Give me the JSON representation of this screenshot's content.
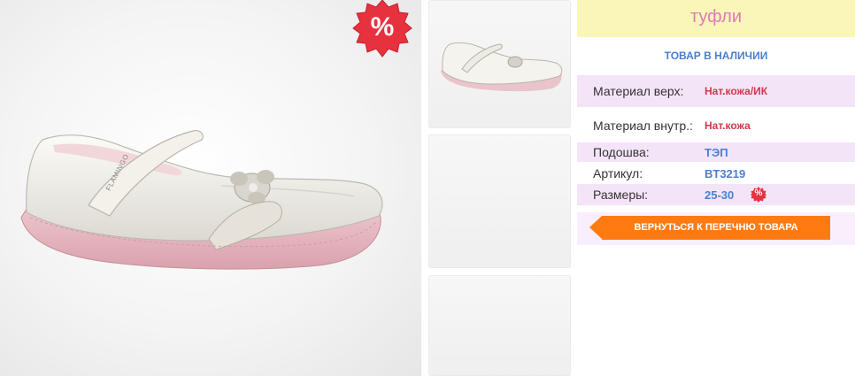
{
  "product": {
    "title": "туфли",
    "stock_status": "ТОВАР В НАЛИЧИИ",
    "sale_badge": "%",
    "shoe_brand_text": "FLAMINGO",
    "specs": [
      {
        "label": "Материал верх:",
        "value": "Нат.кожа/ИК"
      },
      {
        "label": "Материал внутр.:",
        "value": "Нат.кожа"
      },
      {
        "label": "Подошва:",
        "value": "ТЭП"
      },
      {
        "label": "Артикул:",
        "value": "BT3219"
      },
      {
        "label": "Размеры:",
        "value": "25-30",
        "badge": "%"
      }
    ],
    "back_button": "ВЕРНУТЬСЯ К ПЕРЕЧНЮ ТОВАРА"
  },
  "colors": {
    "title_bg": "#faf6b9",
    "title_text": "#e07ab6",
    "accent_blue": "#4a7fcf",
    "value_red": "#cc3a4a",
    "row_pink": "#f4e4f8",
    "button_orange": "#ff7b12",
    "badge_red": "#e8313f"
  }
}
